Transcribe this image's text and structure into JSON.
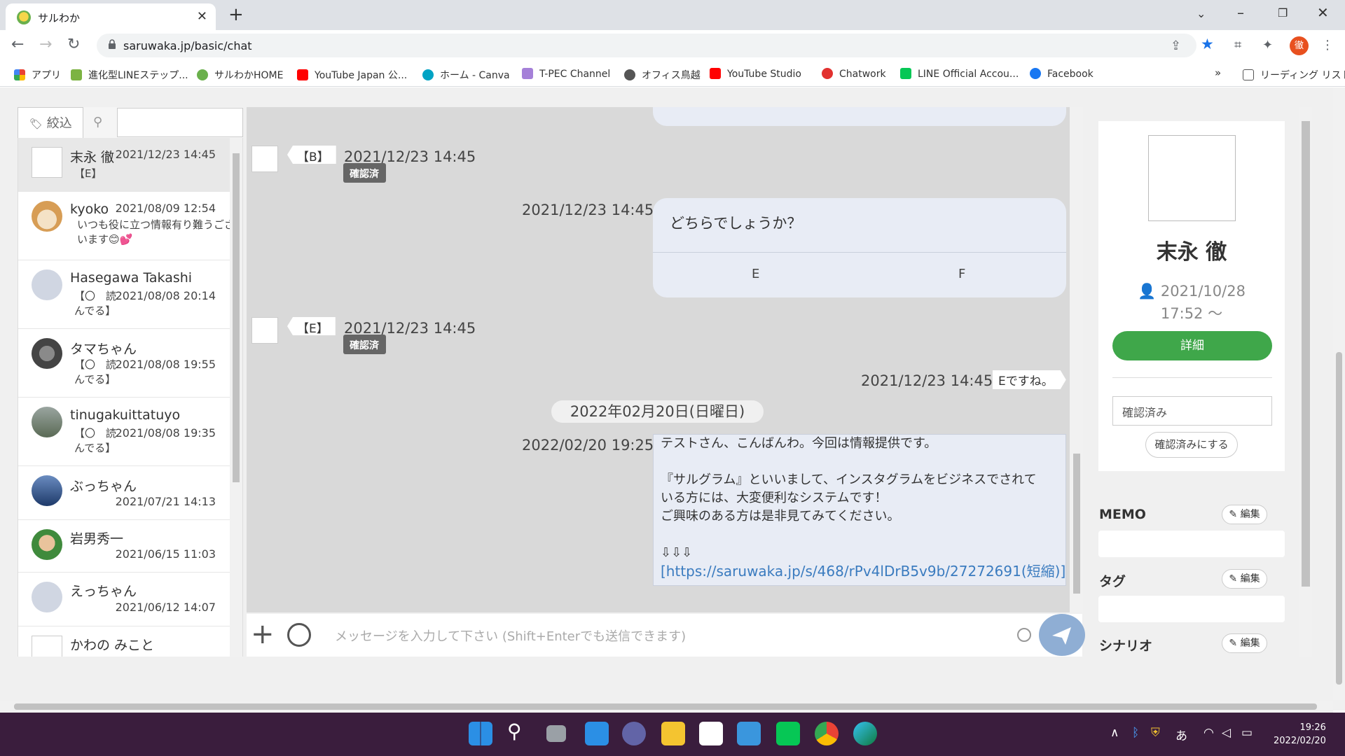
{
  "browser": {
    "tab_title": "サルわか",
    "url": "saruwaka.jp/basic/chat",
    "reading_list": "リーディング リスト",
    "profile_initial": "徹",
    "bookmarks": [
      {
        "label": "アプリ",
        "color": "#e94235"
      },
      {
        "label": "進化型LINEステップ...",
        "color": "#7cb342"
      },
      {
        "label": "サルわかHOME",
        "color": "#6ab04c"
      },
      {
        "label": "YouTube Japan 公...",
        "color": "#ff0000"
      },
      {
        "label": "ホーム - Canva",
        "color": "#00a3c4"
      },
      {
        "label": "T-PEC Channel",
        "color": "#a580d8"
      },
      {
        "label": "オフィス鳥越",
        "color": "#555555"
      },
      {
        "label": "YouTube Studio",
        "color": "#ff0000"
      },
      {
        "label": "Chatwork",
        "color": "#e2312f"
      },
      {
        "label": "LINE Official Accou...",
        "color": "#06c755"
      },
      {
        "label": "Facebook",
        "color": "#1877f2"
      }
    ]
  },
  "sidebar": {
    "filter_label": "絞込",
    "contacts": [
      {
        "name": "末永 徹",
        "time": "2021/12/23 14:45",
        "snippet": "【E】"
      },
      {
        "name": "kyoko",
        "time": "2021/08/09 12:54",
        "snippet": "いつも役に立つ情報有り難うございます😊💕"
      },
      {
        "name": "Hasegawa Takashi",
        "time": "2021/08/08 20:14",
        "snippet": "【〇　読んでる】"
      },
      {
        "name": "タマちゃん",
        "time": "2021/08/08 19:55",
        "snippet": "【〇　読んでる】"
      },
      {
        "name": "tinugakuittatuyo",
        "time": "2021/08/08 19:35",
        "snippet": "【〇　読んでる】"
      },
      {
        "name": "ぶっちゃん",
        "time": "2021/07/21 14:13",
        "snippet": ""
      },
      {
        "name": "岩男秀一",
        "time": "2021/06/15 11:03",
        "snippet": ""
      },
      {
        "name": "えっちゃん",
        "time": "2021/06/12 14:07",
        "snippet": ""
      },
      {
        "name": "かわの みこと",
        "time": "",
        "snippet": ""
      }
    ]
  },
  "chat": {
    "msg1": {
      "tag": "【B】",
      "time": "2021/12/23 14:45",
      "badge": "確認済"
    },
    "choice": {
      "time": "2021/12/23 14:45",
      "question": "どちらでしょうか？",
      "option_e": "E",
      "option_f": "F"
    },
    "msg2": {
      "tag": "【E】",
      "time": "2021/12/23 14:45",
      "badge": "確認済"
    },
    "reply": {
      "time": "2021/12/23 14:45",
      "text": "Eですね。"
    },
    "date_separator": "2022年02月20日(日曜日)",
    "info": {
      "time": "2022/02/20 19:25",
      "line1": "テストさん、こんばんわ。今回は情報提供です。",
      "line2": "『サルグラム』といいまして、インスタグラムをビジネスでされて",
      "line3": "いる方には、大変便利なシステムです！",
      "line4": "ご興味のある方は是非見てみてください。",
      "line5": "⇩⇩⇩",
      "link": "[https://saruwaka.jp/s/468/rPv4lDrB5v9b/27272691(短縮)]"
    },
    "input_placeholder": "メッセージを入力して下さい (Shift+Enterでも送信できます)"
  },
  "profile": {
    "name": "末永 徹",
    "date_line1": "2021/10/28",
    "date_line2": "17:52 ～",
    "detail_button": "詳細",
    "status_value": "確認済み",
    "mark_button": "確認済みにする",
    "memo_title": "MEMO",
    "tag_title": "タグ",
    "scenario_title": "シナリオ",
    "edit_label": "編集"
  },
  "taskbar": {
    "time": "19:26",
    "date": "2022/02/20",
    "ime": "あ"
  }
}
